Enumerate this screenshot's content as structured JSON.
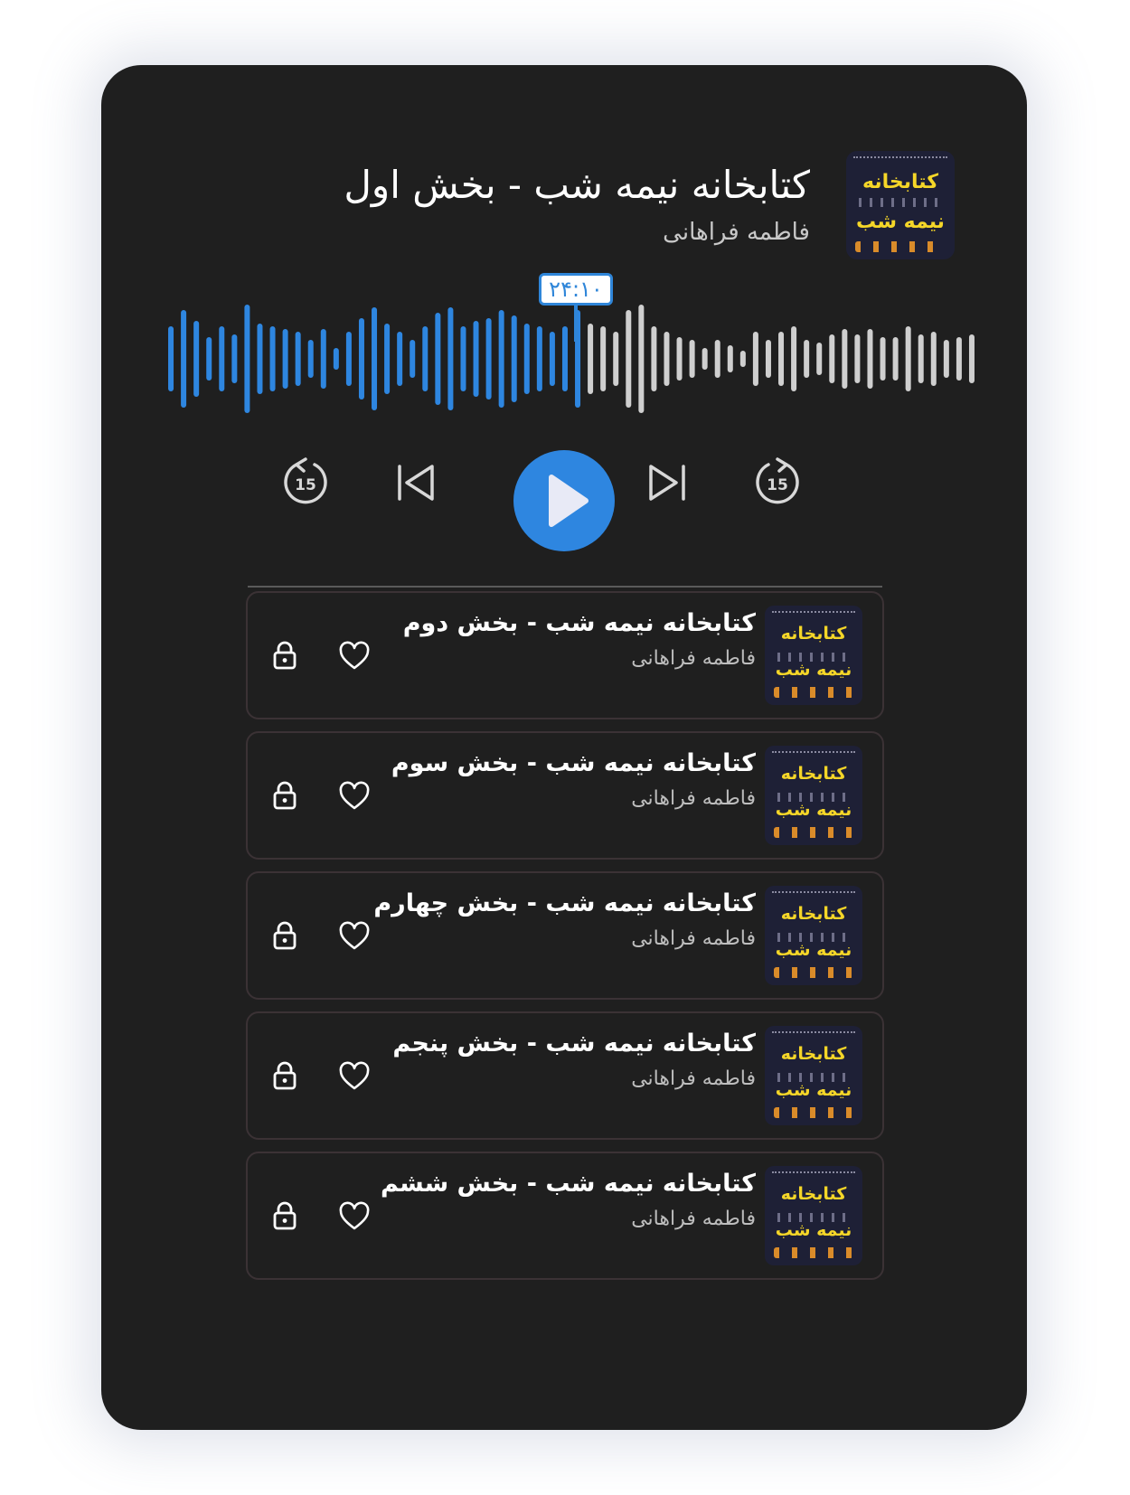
{
  "now_playing": {
    "title": "کتابخانه نیمه شب - بخش اول",
    "author": "فاطمه فراهانی",
    "cover": {
      "line1": "کتابخانه",
      "line2": "نیمه شب"
    },
    "current_time": "۲۴:۱۰",
    "progress": 0.51
  },
  "waveform": {
    "bars": [
      0.55,
      0.85,
      0.65,
      0.35,
      0.55,
      0.4,
      0.95,
      0.6,
      0.55,
      0.5,
      0.45,
      0.3,
      0.5,
      0.15,
      0.45,
      0.7,
      0.9,
      0.6,
      0.45,
      0.3,
      0.55,
      0.8,
      0.9,
      0.55,
      0.65,
      0.7,
      0.85,
      0.75,
      0.6,
      0.55,
      0.45,
      0.55,
      0.85,
      0.6,
      0.55,
      0.45,
      0.85,
      0.95,
      0.55,
      0.45,
      0.35,
      0.3,
      0.15,
      0.3,
      0.2,
      0.1,
      0.45,
      0.3,
      0.45,
      0.55,
      0.3,
      0.25,
      0.4,
      0.5,
      0.4,
      0.5,
      0.35,
      0.35,
      0.55,
      0.4,
      0.45,
      0.3,
      0.35,
      0.4
    ],
    "played_color": "#2e86e0",
    "unplayed_color": "#cfcfcf"
  },
  "controls": {
    "rewind_seconds": "15",
    "forward_seconds": "15",
    "icons": [
      "rewind-15-icon",
      "skip-back-icon",
      "play-icon",
      "skip-forward-icon",
      "forward-15-icon"
    ]
  },
  "playlist": [
    {
      "title": "کتابخانه نیمه شب - بخش دوم",
      "author": "فاطمه فراهانی",
      "cover": {
        "line1": "کتابخانه",
        "line2": "نیمه شب"
      }
    },
    {
      "title": "کتابخانه نیمه شب - بخش سوم",
      "author": "فاطمه فراهانی",
      "cover": {
        "line1": "کتابخانه",
        "line2": "نیمه شب"
      }
    },
    {
      "title": "کتابخانه نیمه شب - بخش چهارم",
      "author": "فاطمه فراهانی",
      "cover": {
        "line1": "کتابخانه",
        "line2": "نیمه شب"
      }
    },
    {
      "title": "کتابخانه نیمه شب - بخش پنجم",
      "author": "فاطمه فراهانی",
      "cover": {
        "line1": "کتابخانه",
        "line2": "نیمه شب"
      }
    },
    {
      "title": "کتابخانه نیمه شب - بخش ششم",
      "author": "فاطمه فراهانی",
      "cover": {
        "line1": "کتابخانه",
        "line2": "نیمه شب"
      }
    }
  ],
  "colors": {
    "accent": "#2e86e0",
    "card_bg": "#1f1f1f",
    "text": "#ffffff",
    "subtext": "#c8c8c8"
  }
}
